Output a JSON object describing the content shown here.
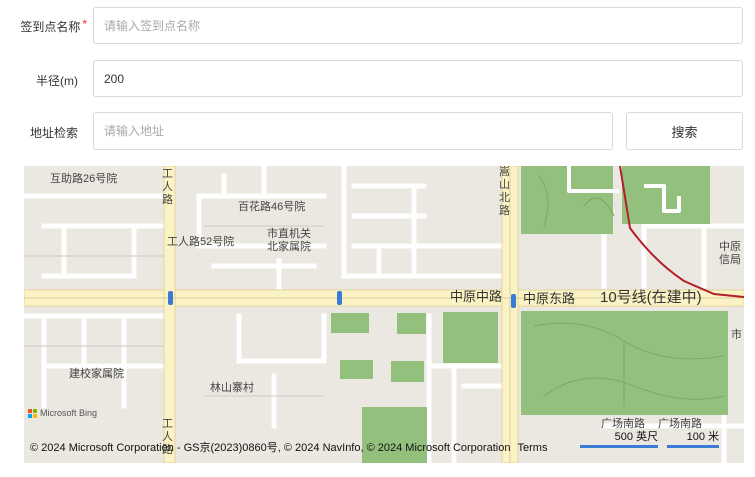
{
  "form": {
    "name_label": "签到点名称",
    "name_required": "*",
    "name_placeholder": "请输入签到点名称",
    "radius_label": "半径(m)",
    "radius_value": "200",
    "address_label": "地址检索",
    "address_placeholder": "请输入地址",
    "search_label": "搜索"
  },
  "map": {
    "labels": {
      "l1": "互助路26号院",
      "l2": "工人路",
      "l3": "百花路46号院",
      "l4": "工人路52号院",
      "l5a": "市直机关",
      "l5b": "北家属院",
      "l6": "嵩山北路",
      "l7": "中原中路",
      "l8": "中原东路",
      "l9": "10号线(在建中)",
      "l10a": "中原",
      "l10b": "信局",
      "l11": "建校家属院",
      "l12": "林山寨村",
      "l13": "广场南路",
      "l14": "广场南路",
      "l15": "市",
      "l16": "工人路"
    },
    "bing_text": "Microsoft Bing",
    "copyright": "© 2024 Microsoft Corporation - GS京(2023)0860号, © 2024 NavInfo, © 2024 Microsoft Corporation",
    "terms": "Terms",
    "scale_imperial": "500 英尺",
    "scale_metric": "100 米",
    "colors": {
      "background": "#ebe7e1",
      "park": "#94c07e",
      "road_main": "#fbf3c5",
      "road_minor": "#ffffff",
      "metro_line": "#b21f2b",
      "scale_bar": "#3a7bd5"
    }
  }
}
